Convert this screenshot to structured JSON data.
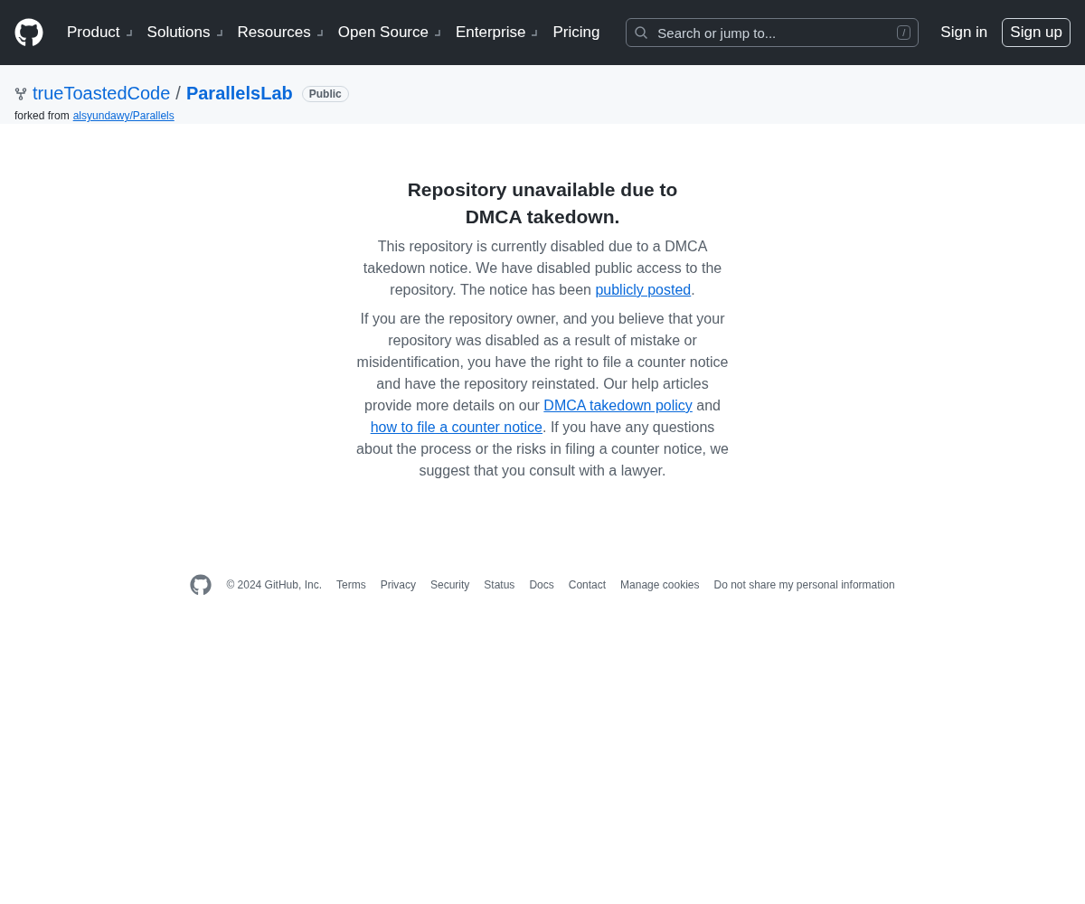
{
  "header": {
    "nav": [
      {
        "label": "Product",
        "has_menu": true
      },
      {
        "label": "Solutions",
        "has_menu": true
      },
      {
        "label": "Resources",
        "has_menu": true
      },
      {
        "label": "Open Source",
        "has_menu": true
      },
      {
        "label": "Enterprise",
        "has_menu": true
      },
      {
        "label": "Pricing",
        "has_menu": false
      }
    ],
    "search": {
      "placeholder": "Search or jump to...",
      "shortcut": "/"
    },
    "sign_in": "Sign in",
    "sign_up": "Sign up"
  },
  "repo": {
    "owner": "trueToastedCode",
    "separator": "/",
    "name": "ParallelsLab",
    "visibility": "Public",
    "forked_label": "forked from",
    "forked_source": "alsyundawy/Parallels"
  },
  "notice": {
    "title": "Repository unavailable due to DMCA takedown.",
    "paragraphs": [
      [
        {
          "kind": "text",
          "text": "This repository is currently disabled due to a DMCA takedown notice. We have disabled public access to the repository. The notice has been "
        },
        {
          "kind": "link",
          "text": "publicly posted"
        },
        {
          "kind": "text",
          "text": "."
        }
      ],
      [
        {
          "kind": "text",
          "text": "If you are the repository owner, and you believe that your repository was disabled as a result of mistake or misidentification, you have the right to file a counter notice and have the repository reinstated. Our help articles provide more details on our "
        },
        {
          "kind": "link",
          "text": "DMCA takedown policy"
        },
        {
          "kind": "text",
          "text": " and "
        },
        {
          "kind": "link",
          "text": "how to file a counter notice"
        },
        {
          "kind": "text",
          "text": ". If you have any questions about the process or the risks in filing a counter notice, we suggest that you consult with a lawyer."
        }
      ]
    ]
  },
  "footer": {
    "copyright": "© 2024 GitHub, Inc.",
    "links": [
      "Terms",
      "Privacy",
      "Security",
      "Status",
      "Docs",
      "Contact",
      "Manage cookies",
      "Do not share my personal information"
    ]
  }
}
